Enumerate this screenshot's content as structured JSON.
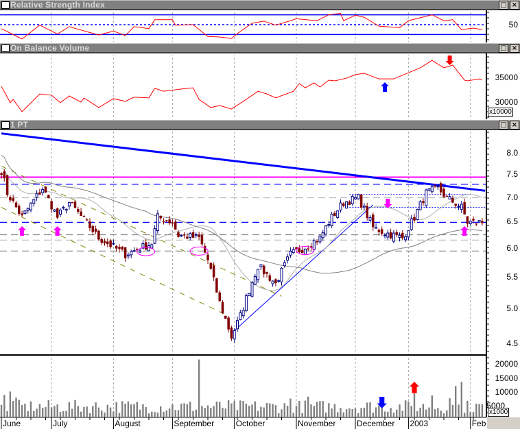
{
  "panels": {
    "rsi": {
      "title": "Relative Strength Index",
      "labels": [
        "50"
      ]
    },
    "obv": {
      "title": "On Balance Volume",
      "labels": [
        "35000",
        "30000"
      ],
      "multiplier": "x10000"
    },
    "price": {
      "title": "1 PT",
      "labels": [
        "8.0",
        "7.5",
        "7.0",
        "6.5",
        "6.0",
        "5.5",
        "5.0",
        "4.5"
      ]
    },
    "volume": {
      "labels": [
        "20000",
        "15000",
        "10000",
        "5000"
      ],
      "multiplier": "x1000"
    }
  },
  "window_buttons": {
    "restore": "□",
    "close": "×"
  },
  "x_axis": {
    "months": [
      "June",
      "July",
      "August",
      "September",
      "October",
      "November",
      "December",
      "2003",
      "Feb"
    ],
    "month_start_bars": [
      0,
      17,
      38,
      58,
      79,
      100,
      120,
      138,
      159
    ],
    "bar_count": 164
  },
  "colors": {
    "up_candle": "#000080",
    "down_candle": "#800000",
    "rsi_line": "#ff0000",
    "obv_line": "#ff0000",
    "volume_bar": "#808080",
    "annotation": "#ff00ff"
  },
  "chart_data": [
    {
      "type": "candlestick",
      "name": "1 PT",
      "scale": "log",
      "ylim": [
        4.3,
        8.6
      ],
      "yticks": [
        8.0,
        7.5,
        7.0,
        6.5,
        6.0,
        5.5,
        5.0,
        4.5
      ],
      "close_waypoints": [
        [
          0,
          7.6
        ],
        [
          2,
          7.1
        ],
        [
          7,
          6.6
        ],
        [
          14,
          7.2
        ],
        [
          19,
          6.6
        ],
        [
          23,
          6.9
        ],
        [
          33,
          6.2
        ],
        [
          42,
          5.9
        ],
        [
          51,
          6.1
        ],
        [
          53,
          6.6
        ],
        [
          58,
          6.5
        ],
        [
          60,
          6.25
        ],
        [
          67,
          6.2
        ],
        [
          70,
          5.8
        ],
        [
          74,
          5.1
        ],
        [
          78,
          4.6
        ],
        [
          81,
          4.9
        ],
        [
          87,
          5.7
        ],
        [
          93,
          5.4
        ],
        [
          98,
          5.9
        ],
        [
          102,
          6.0
        ],
        [
          108,
          6.2
        ],
        [
          112,
          6.6
        ],
        [
          116,
          6.9
        ],
        [
          121,
          7.0
        ],
        [
          126,
          6.4
        ],
        [
          130,
          6.3
        ],
        [
          136,
          6.2
        ],
        [
          140,
          6.6
        ],
        [
          144,
          7.1
        ],
        [
          148,
          7.2
        ],
        [
          151,
          7.0
        ],
        [
          156,
          6.8
        ],
        [
          158,
          6.5
        ],
        [
          163,
          6.5
        ]
      ],
      "moving_averages": [
        {
          "period": 20,
          "color": "#b0b0b0"
        },
        {
          "period": 50,
          "color": "#808080"
        }
      ],
      "horizontal_levels": [
        {
          "price": 7.45,
          "color": "#ff00ff",
          "style": "solid"
        },
        {
          "price": 7.29,
          "color": "#0000ff",
          "style": "dashed"
        },
        {
          "price": 7.0,
          "color": "#b8b8b8",
          "style": "dashed"
        },
        {
          "price": 6.5,
          "color": "#0000ff",
          "style": "dashed"
        },
        {
          "price": 6.26,
          "color": "#808080",
          "style": "dashed"
        },
        {
          "price": 6.16,
          "color": "#c0c0c0",
          "style": "dashed"
        },
        {
          "price": 5.96,
          "color": "#808080",
          "style": "dashed"
        }
      ],
      "trendlines": [
        {
          "from": [
            0,
            8.5
          ],
          "to": [
            164,
            7.15
          ],
          "color": "#0000ff",
          "style": "solid",
          "weight": "heavy"
        },
        {
          "from": [
            0,
            7.7
          ],
          "to": [
            95,
            5.2
          ],
          "color": "#808000",
          "style": "dashed",
          "weight": "thin"
        },
        {
          "from": [
            0,
            6.8
          ],
          "to": [
            77,
            4.9
          ],
          "color": "#808000",
          "style": "dashed",
          "weight": "thin"
        },
        {
          "from": [
            78,
            4.65
          ],
          "to": [
            126,
            6.85
          ],
          "color": "#0000ff",
          "style": "solid",
          "weight": "thin"
        },
        {
          "from": [
            118,
            7.07
          ],
          "to": [
            159,
            7.07
          ],
          "color": "#0000ff",
          "style": "dotted",
          "weight": "thin"
        },
        {
          "from": [
            118,
            6.8
          ],
          "to": [
            164,
            6.8
          ],
          "color": "#0000ff",
          "style": "dotted",
          "weight": "thin"
        }
      ],
      "marked_bars": {
        "up_arrows": [
          7,
          19,
          157
        ],
        "down_arrows": [
          131
        ],
        "ellipses": [
          [
            49,
            5.95
          ],
          [
            67,
            5.96
          ],
          [
            103,
            5.97
          ]
        ]
      }
    },
    {
      "type": "line",
      "name": "Relative Strength Index",
      "ylim": [
        15,
        80
      ],
      "reference_levels": [
        70,
        50,
        30
      ],
      "points": [
        [
          0,
          42
        ],
        [
          7,
          21
        ],
        [
          13,
          49
        ],
        [
          19,
          31
        ],
        [
          23,
          46
        ],
        [
          33,
          29
        ],
        [
          38,
          37
        ],
        [
          42,
          28
        ],
        [
          45,
          46
        ],
        [
          50,
          42
        ],
        [
          52,
          60
        ],
        [
          58,
          60
        ],
        [
          59,
          49
        ],
        [
          65,
          50
        ],
        [
          70,
          26
        ],
        [
          74,
          25
        ],
        [
          78,
          22
        ],
        [
          80,
          32
        ],
        [
          85,
          53
        ],
        [
          89,
          57
        ],
        [
          93,
          49
        ],
        [
          98,
          58
        ],
        [
          100,
          62
        ],
        [
          107,
          58
        ],
        [
          111,
          70
        ],
        [
          115,
          73
        ],
        [
          116,
          58
        ],
        [
          120,
          69
        ],
        [
          123,
          65
        ],
        [
          128,
          47
        ],
        [
          135,
          44
        ],
        [
          138,
          58
        ],
        [
          142,
          64
        ],
        [
          146,
          70
        ],
        [
          150,
          58
        ],
        [
          153,
          60
        ],
        [
          156,
          40
        ],
        [
          160,
          43
        ],
        [
          163,
          40
        ]
      ]
    },
    {
      "type": "line",
      "name": "On Balance Volume",
      "multiplier": 10000,
      "ylim": [
        27000,
        40000
      ],
      "yticks": [
        35000,
        30000
      ],
      "points": [
        [
          0,
          33200
        ],
        [
          3,
          29900
        ],
        [
          4,
          30550
        ],
        [
          7,
          28050
        ],
        [
          13,
          31650
        ],
        [
          17,
          31400
        ],
        [
          20,
          29900
        ],
        [
          23,
          31250
        ],
        [
          27,
          30000
        ],
        [
          28,
          30850
        ],
        [
          33,
          28900
        ],
        [
          38,
          30700
        ],
        [
          42,
          30150
        ],
        [
          45,
          31000
        ],
        [
          50,
          30850
        ],
        [
          52,
          32800
        ],
        [
          55,
          32200
        ],
        [
          61,
          32650
        ],
        [
          65,
          32900
        ],
        [
          67,
          30550
        ],
        [
          71,
          28900
        ],
        [
          74,
          29300
        ],
        [
          78,
          28600
        ],
        [
          83,
          30550
        ],
        [
          87,
          32200
        ],
        [
          90,
          31650
        ],
        [
          93,
          30850
        ],
        [
          99,
          32200
        ],
        [
          101,
          33750
        ],
        [
          103,
          32900
        ],
        [
          106,
          33900
        ],
        [
          108,
          33050
        ],
        [
          111,
          34450
        ],
        [
          113,
          34300
        ],
        [
          117,
          34850
        ],
        [
          120,
          35550
        ],
        [
          123,
          35850
        ],
        [
          128,
          34700
        ],
        [
          133,
          34700
        ],
        [
          138,
          35950
        ],
        [
          142,
          36950
        ],
        [
          146,
          38450
        ],
        [
          150,
          36950
        ],
        [
          153,
          37500
        ],
        [
          157,
          34450
        ],
        [
          158,
          34300
        ],
        [
          162,
          34700
        ],
        [
          163,
          34450
        ]
      ],
      "annotations": {
        "up_arrow_bar": 130,
        "down_arrow_bar": 152
      }
    },
    {
      "type": "bar",
      "name": "Volume",
      "multiplier": 1000,
      "ylim": [
        0,
        21500
      ],
      "yticks": [
        20000,
        15000,
        10000,
        5000
      ],
      "base_range": [
        1200,
        6000
      ],
      "spikes": [
        [
          1,
          7800
        ],
        [
          3,
          9000
        ],
        [
          5,
          6800
        ],
        [
          67,
          20500
        ],
        [
          98,
          6500
        ],
        [
          104,
          7200
        ],
        [
          140,
          8300
        ],
        [
          146,
          7600
        ],
        [
          152,
          6600
        ],
        [
          154,
          11000
        ],
        [
          156,
          12500
        ]
      ],
      "annotations": {
        "down_arrow_bar": 129,
        "up_arrow_bar": 140
      }
    }
  ]
}
